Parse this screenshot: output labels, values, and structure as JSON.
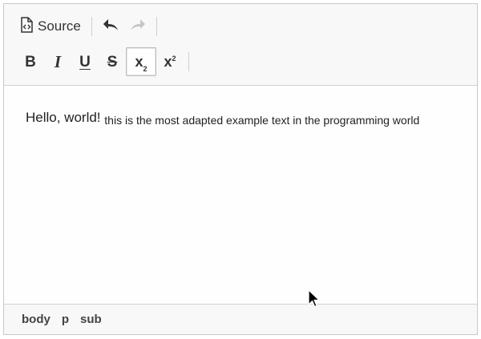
{
  "toolbar": {
    "source_label": "Source",
    "buttons": {
      "source": "source-icon",
      "undo": "undo-icon",
      "redo": "redo-icon",
      "bold": "B",
      "italic": "I",
      "underline": "U",
      "strike": "S",
      "subscript": "x",
      "subscript_mark": "2",
      "superscript": "x",
      "superscript_mark": "2"
    },
    "active": "subscript",
    "disabled": [
      "redo"
    ]
  },
  "content": {
    "main_text": "Hello, world!",
    "sub_text": "this is the most adapted example text in the programming world"
  },
  "statusbar": {
    "path": [
      "body",
      "p",
      "sub"
    ]
  }
}
